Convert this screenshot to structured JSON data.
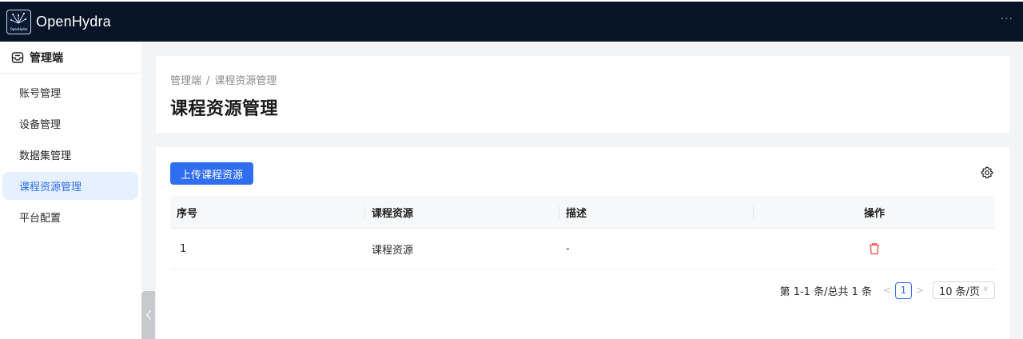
{
  "app": {
    "title": "OpenHydra",
    "logo_text": "OpenHydra"
  },
  "topbar": {
    "more_icon": "more-horizontal-icon",
    "more_glyph": "···"
  },
  "sidebar": {
    "header": "管理端",
    "header_icon": "inbox-icon",
    "items": [
      {
        "label": "账号管理",
        "active": false
      },
      {
        "label": "设备管理",
        "active": false
      },
      {
        "label": "数据集管理",
        "active": false
      },
      {
        "label": "课程资源管理",
        "active": true
      },
      {
        "label": "平台配置",
        "active": false
      }
    ],
    "collapse_icon": "chevron-left-icon"
  },
  "page": {
    "breadcrumb": [
      "管理端",
      "课程资源管理"
    ],
    "breadcrumb_sep": "/",
    "title": "课程资源管理"
  },
  "toolbar": {
    "upload_label": "上传课程资源",
    "settings_icon": "gear-icon"
  },
  "table": {
    "columns": [
      "序号",
      "课程资源",
      "描述",
      "操作"
    ],
    "rows": [
      {
        "index": "1",
        "resource": "课程资源",
        "description": "-",
        "action_icon": "trash-icon"
      }
    ]
  },
  "pagination": {
    "total_text": "第 1-1 条/总共 1 条",
    "current_page": "1",
    "page_size": "10 条/页",
    "prev_glyph": "<",
    "next_glyph": ">",
    "select_glyph": "∨"
  },
  "colors": {
    "topbar_bg": "#071327",
    "accent": "#2f6ef0",
    "active_menu_bg": "#e6f0ff",
    "danger": "#ff4d4f",
    "content_bg": "#f3f4f5"
  }
}
